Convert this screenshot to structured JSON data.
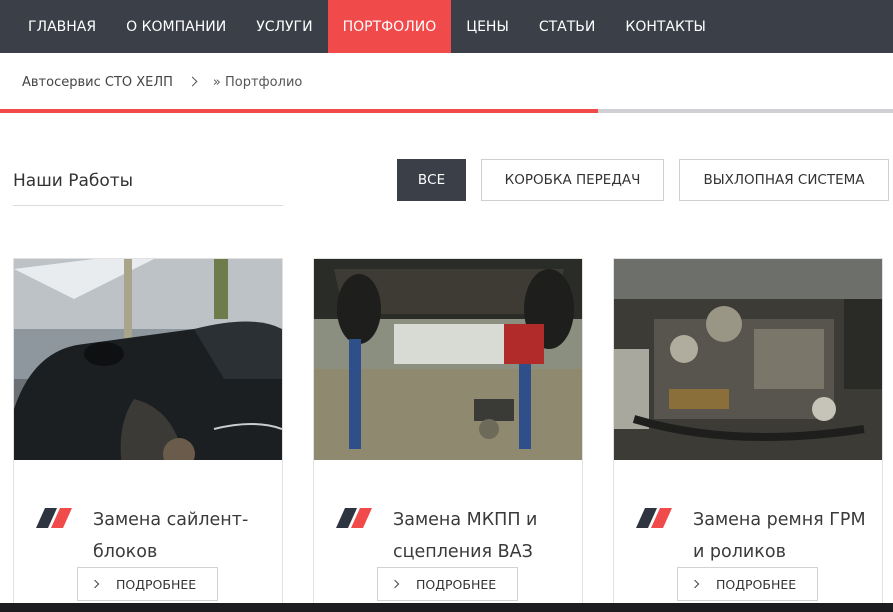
{
  "nav": {
    "items": [
      {
        "label": "Главная",
        "active": false
      },
      {
        "label": "О компании",
        "active": false
      },
      {
        "label": "Услуги",
        "active": false
      },
      {
        "label": "Портфолио",
        "active": true
      },
      {
        "label": "Цены",
        "active": false
      },
      {
        "label": "Статьи",
        "active": false
      },
      {
        "label": "Контакты",
        "active": false
      }
    ]
  },
  "breadcrumb": {
    "home": "Автосервис СТО ХЕЛП",
    "separator_icon": "chevron-right-icon",
    "current": "» Портфолио"
  },
  "progress": {
    "value": 0.67
  },
  "section": {
    "title": "Наши Работы"
  },
  "filters": [
    {
      "label": "Все",
      "active": true
    },
    {
      "label": "Коробка передач",
      "active": false
    },
    {
      "label": "Выхлопная система",
      "active": false
    }
  ],
  "cards": [
    {
      "title": "Замена сайлент-блоков",
      "title_lines": [
        "Замена сайлент-",
        "блоков"
      ],
      "button": "Подробнее"
    },
    {
      "title": "Замена МКПП и сцепления ВАЗ",
      "title_lines": [
        "Замена МКПП и",
        "сцепления ВАЗ"
      ],
      "button": "Подробнее"
    },
    {
      "title": "Замена ремня ГРМ и роликов",
      "title_lines": [
        "Замена ремня ГРМ",
        "и роликов"
      ],
      "button": "Подробнее"
    }
  ],
  "colors": {
    "nav_bg": "#3a3f48",
    "accent": "#f04a4a",
    "logo_dark": "#2f3540",
    "logo_red": "#f04a4a"
  }
}
